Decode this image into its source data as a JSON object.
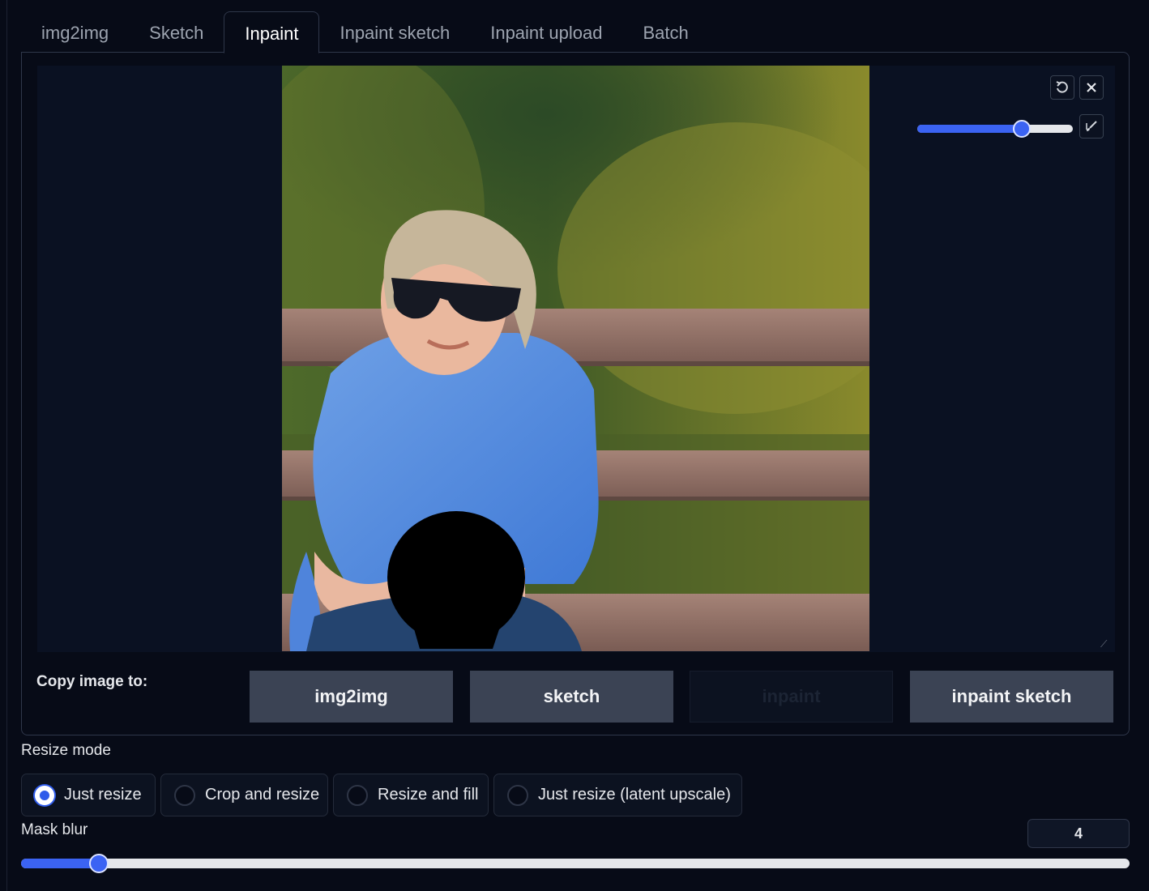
{
  "tabs": [
    {
      "label": "img2img",
      "active": false
    },
    {
      "label": "Sketch",
      "active": false
    },
    {
      "label": "Inpaint",
      "active": true
    },
    {
      "label": "Inpaint sketch",
      "active": false
    },
    {
      "label": "Inpaint upload",
      "active": false
    },
    {
      "label": "Batch",
      "active": false
    }
  ],
  "canvas": {
    "toolbar": {
      "undo_icon": "undo-icon",
      "clear_icon": "close-icon",
      "brush_icon": "brush-icon",
      "brush_size_fraction": 0.67
    }
  },
  "copy_row": {
    "label": "Copy image to:",
    "buttons": [
      {
        "label": "img2img",
        "enabled": true
      },
      {
        "label": "sketch",
        "enabled": true
      },
      {
        "label": "inpaint",
        "enabled": false
      },
      {
        "label": "inpaint sketch",
        "enabled": true
      }
    ]
  },
  "resize_mode": {
    "label": "Resize mode",
    "options": [
      "Just resize",
      "Crop and resize",
      "Resize and fill",
      "Just resize (latent upscale)"
    ],
    "selected": "Just resize"
  },
  "mask_blur": {
    "label": "Mask blur",
    "value": "4",
    "fraction": 0.07
  },
  "colors": {
    "accent": "#3b63f3",
    "background": "#070b17",
    "button": "#3b4354"
  }
}
